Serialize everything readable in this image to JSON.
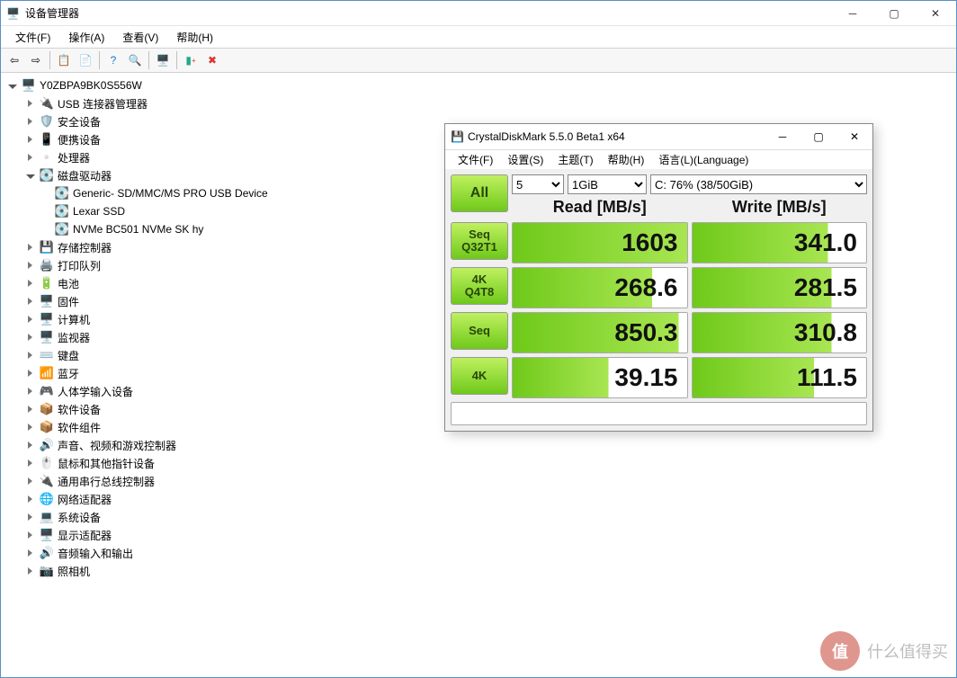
{
  "window": {
    "title": "设备管理器",
    "menu": [
      "文件(F)",
      "操作(A)",
      "查看(V)",
      "帮助(H)"
    ]
  },
  "tree": {
    "root": "Y0ZBPA9BK0S556W",
    "items": [
      {
        "label": "USB 连接器管理器",
        "chev": "closed",
        "icon": "🔌"
      },
      {
        "label": "安全设备",
        "chev": "closed",
        "icon": "🛡️"
      },
      {
        "label": "便携设备",
        "chev": "closed",
        "icon": "📱"
      },
      {
        "label": "处理器",
        "chev": "closed",
        "icon": "▫️"
      },
      {
        "label": "磁盘驱动器",
        "chev": "open",
        "icon": "💽",
        "children": [
          {
            "label": "Generic- SD/MMC/MS PRO USB Device",
            "icon": "💽"
          },
          {
            "label": "Lexar SSD",
            "icon": "💽"
          },
          {
            "label": "NVMe BC501 NVMe SK hy",
            "icon": "💽"
          }
        ]
      },
      {
        "label": "存储控制器",
        "chev": "closed",
        "icon": "💾"
      },
      {
        "label": "打印队列",
        "chev": "closed",
        "icon": "🖨️"
      },
      {
        "label": "电池",
        "chev": "closed",
        "icon": "🔋"
      },
      {
        "label": "固件",
        "chev": "closed",
        "icon": "🖥️"
      },
      {
        "label": "计算机",
        "chev": "closed",
        "icon": "🖥️"
      },
      {
        "label": "监视器",
        "chev": "closed",
        "icon": "🖥️"
      },
      {
        "label": "键盘",
        "chev": "closed",
        "icon": "⌨️"
      },
      {
        "label": "蓝牙",
        "chev": "closed",
        "icon": "📶"
      },
      {
        "label": "人体学输入设备",
        "chev": "closed",
        "icon": "🎮"
      },
      {
        "label": "软件设备",
        "chev": "closed",
        "icon": "📦"
      },
      {
        "label": "软件组件",
        "chev": "closed",
        "icon": "📦"
      },
      {
        "label": "声音、视频和游戏控制器",
        "chev": "closed",
        "icon": "🔊"
      },
      {
        "label": "鼠标和其他指针设备",
        "chev": "closed",
        "icon": "🖱️"
      },
      {
        "label": "通用串行总线控制器",
        "chev": "closed",
        "icon": "🔌"
      },
      {
        "label": "网络适配器",
        "chev": "closed",
        "icon": "🌐"
      },
      {
        "label": "系统设备",
        "chev": "closed",
        "icon": "💻"
      },
      {
        "label": "显示适配器",
        "chev": "closed",
        "icon": "🖥️"
      },
      {
        "label": "音频输入和输出",
        "chev": "closed",
        "icon": "🔊"
      },
      {
        "label": "照相机",
        "chev": "closed",
        "icon": "📷"
      }
    ]
  },
  "cdm": {
    "title": "CrystalDiskMark 5.5.0 Beta1 x64",
    "menu": [
      "文件(F)",
      "设置(S)",
      "主题(T)",
      "帮助(H)",
      "语言(L)(Language)"
    ],
    "all_btn": "All",
    "passes": "5",
    "size": "1GiB",
    "drive": "C: 76% (38/50GiB)",
    "read_hdr": "Read [MB/s]",
    "write_hdr": "Write [MB/s]",
    "rows": [
      {
        "btn": "Seq\nQ32T1",
        "read": "1603",
        "write": "341.0",
        "rfill": "100%",
        "wfill": "78%"
      },
      {
        "btn": "4K\nQ4T8",
        "read": "268.6",
        "write": "281.5",
        "rfill": "80%",
        "wfill": "80%"
      },
      {
        "btn": "Seq",
        "read": "850.3",
        "write": "310.8",
        "rfill": "95%",
        "wfill": "80%"
      },
      {
        "btn": "4K",
        "read": "39.15",
        "write": "111.5",
        "rfill": "55%",
        "wfill": "70%"
      }
    ]
  },
  "watermark": {
    "brand": "值",
    "text": "什么值得买"
  }
}
